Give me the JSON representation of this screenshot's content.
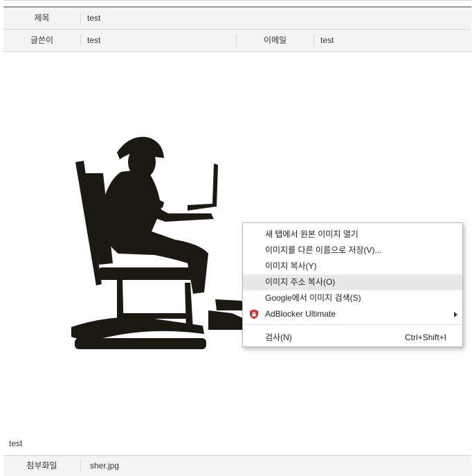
{
  "post": {
    "title_label": "제목",
    "title_value": "test",
    "author_label": "글쓴이",
    "author_value": "test",
    "email_label": "이메일",
    "email_value": "test",
    "body_text": "test",
    "attachment_label": "첨부화일",
    "attachment_value": "sher.jpg"
  },
  "image": {
    "icon": "silhouette-man-rocking-chair-laptop"
  },
  "context_menu": {
    "items": [
      {
        "label": "새 탭에서 원본 이미지 열기"
      },
      {
        "label": "이미지를 다른 이름으로 저장(V)..."
      },
      {
        "label": "이미지 복사(Y)"
      },
      {
        "label": "이미지 주소 복사(O)",
        "highlighted": true
      },
      {
        "label": "Google에서 이미지 검색(S)"
      },
      {
        "label": "AdBlocker Ultimate",
        "icon": "shield-icon",
        "submenu": true
      },
      {
        "label": "검사(N)",
        "shortcut": "Ctrl+Shift+I"
      }
    ]
  },
  "colors": {
    "row_background": "#f4f4f4",
    "highlight": "#e8e8e8",
    "adblock_red": "#d32f2f"
  }
}
